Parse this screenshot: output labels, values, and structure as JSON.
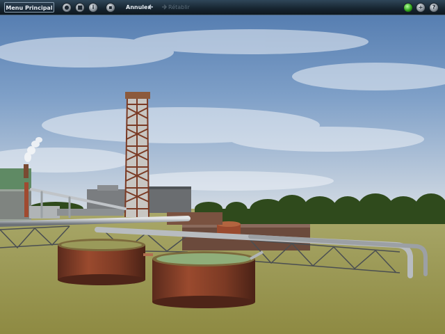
{
  "toolbar": {
    "menu_label": "Menu Principal",
    "undo_label": "Annuler",
    "redo_label": "Rétablir",
    "icons_left": [
      "globe-icon",
      "stop-icon",
      "info-icon",
      "camera-icon"
    ],
    "icons_right": [
      "status-light-icon",
      "add-icon",
      "help-icon"
    ],
    "help_glyph": "?",
    "add_glyph": "+",
    "colors": {
      "bar": "#16242f",
      "accent_green": "#2fa51c"
    }
  },
  "scene": {
    "description_colors": {
      "sky_top": "#5f86b8",
      "sky_horizon": "#cfd9e6",
      "grass": "#9a9a52",
      "rust": "#7a3a26"
    }
  }
}
